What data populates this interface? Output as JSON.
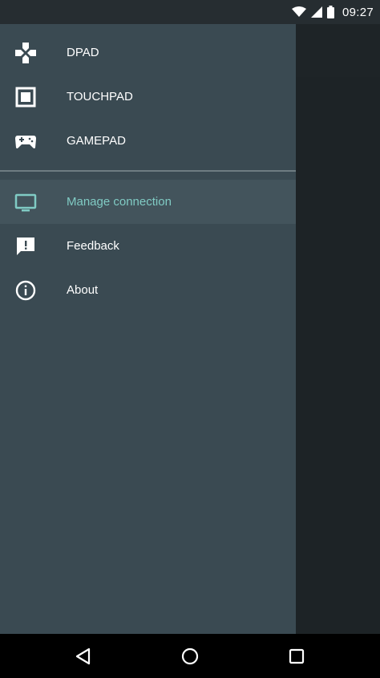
{
  "status_bar": {
    "time": "09:27",
    "icons": [
      "wifi-icon",
      "signal-icon",
      "battery-icon"
    ]
  },
  "drawer": {
    "controls": [
      {
        "label": "DPAD",
        "icon": "dpad-icon"
      },
      {
        "label": "TOUCHPAD",
        "icon": "touchpad-icon"
      },
      {
        "label": "GAMEPAD",
        "icon": "gamepad-icon"
      }
    ],
    "settings": [
      {
        "label": "Manage connection",
        "icon": "tv-icon",
        "active": true
      },
      {
        "label": "Feedback",
        "icon": "feedback-icon",
        "active": false
      },
      {
        "label": "About",
        "icon": "info-icon",
        "active": false
      }
    ]
  },
  "navigation_bar": {
    "buttons": [
      "back-icon",
      "home-icon",
      "recents-icon"
    ]
  },
  "colors": {
    "drawer_bg": "#3a4a52",
    "active_item_bg": "#43545c",
    "accent": "#80cbc4",
    "status_bar_bg": "#262d31",
    "nav_bar_bg": "#000000"
  }
}
